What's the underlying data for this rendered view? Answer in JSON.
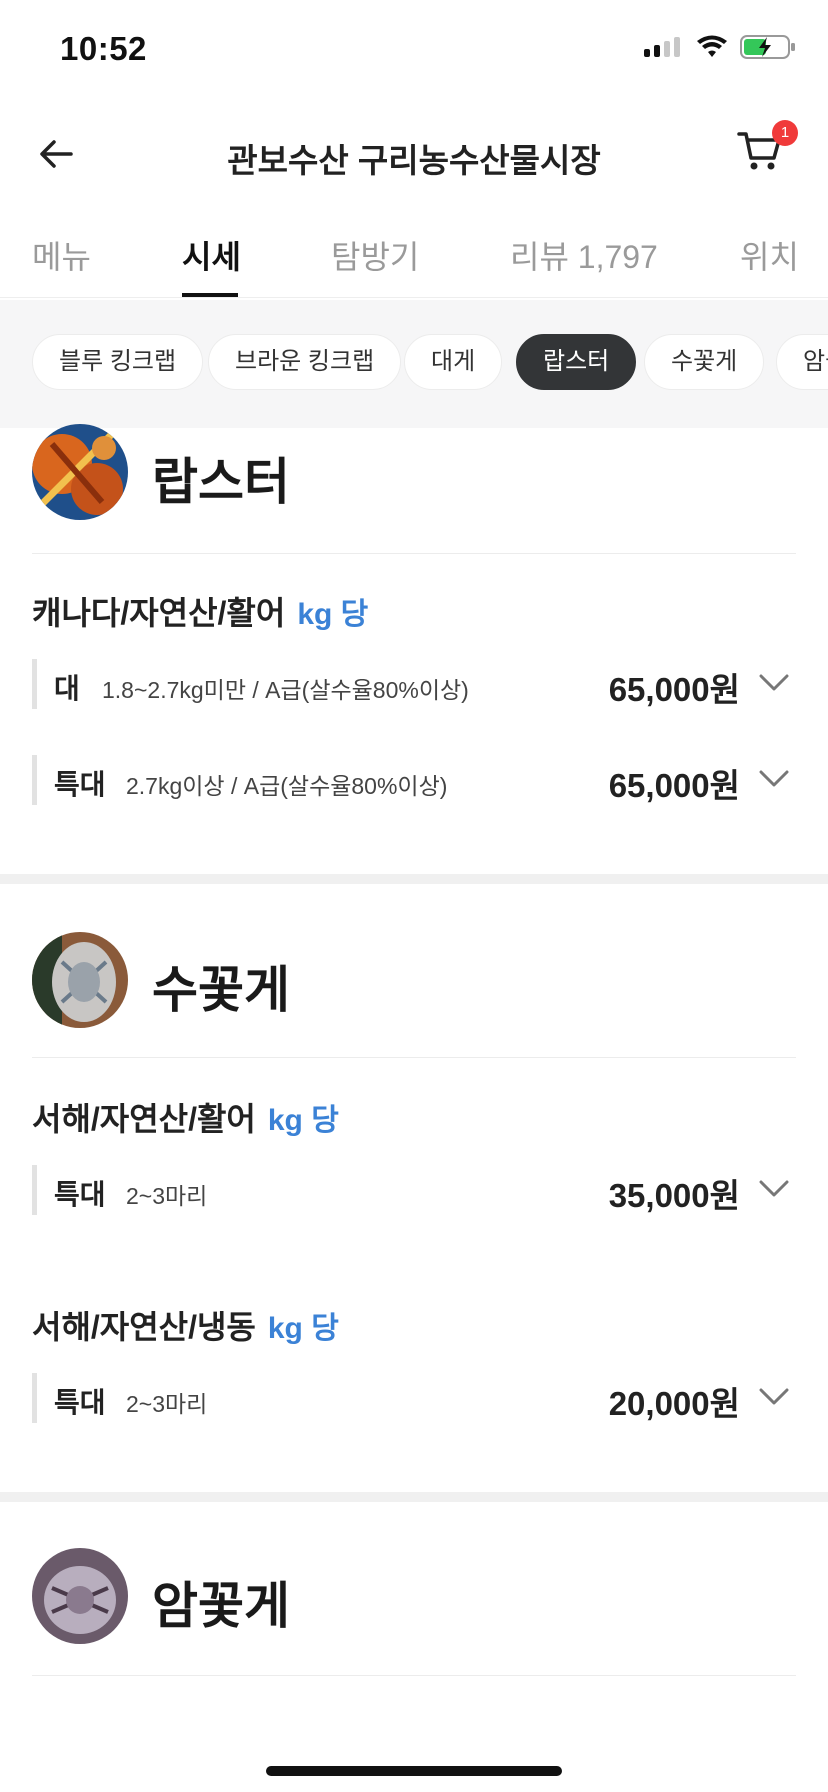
{
  "status": {
    "time": "10:52"
  },
  "nav": {
    "title": "관보수산 구리농수산물시장",
    "cart_count": "1"
  },
  "tabs": [
    {
      "label": "메뉴"
    },
    {
      "label": "시세"
    },
    {
      "label": "탐방기"
    },
    {
      "label": "리뷰 1,797"
    },
    {
      "label": "위치"
    }
  ],
  "chips": [
    {
      "label": "블루 킹크랩"
    },
    {
      "label": "브라운 킹크랩"
    },
    {
      "label": "대게"
    },
    {
      "label": "랍스터"
    },
    {
      "label": "수꽃게"
    },
    {
      "label": "암꽃게"
    }
  ],
  "sections": [
    {
      "title": "랍스터",
      "groups": [
        {
          "title": "캐나다/자연산/활어",
          "unit": "kg 당",
          "rows": [
            {
              "grade": "대",
              "desc": "1.8~2.7kg미만 / A급(살수율80%이상)",
              "price": "65,000원"
            },
            {
              "grade": "특대",
              "desc": "2.7kg이상 / A급(살수율80%이상)",
              "price": "65,000원"
            }
          ]
        }
      ]
    },
    {
      "title": "수꽃게",
      "groups": [
        {
          "title": "서해/자연산/활어",
          "unit": "kg 당",
          "rows": [
            {
              "grade": "특대",
              "desc": "2~3마리",
              "price": "35,000원"
            }
          ]
        },
        {
          "title": "서해/자연산/냉동",
          "unit": "kg 당",
          "rows": [
            {
              "grade": "특대",
              "desc": "2~3마리",
              "price": "20,000원"
            }
          ]
        }
      ]
    },
    {
      "title": "암꽃게",
      "groups": []
    }
  ],
  "icons": {
    "back": "arrow-left-icon",
    "cart": "cart-icon",
    "chevron": "chevron-down-icon",
    "signal": "signal-icon",
    "wifi": "wifi-icon",
    "battery": "battery-charging-icon"
  },
  "colors": {
    "accent_blue": "#3b82d6",
    "chip_active": "#333537",
    "badge_red": "#f03a3a"
  }
}
